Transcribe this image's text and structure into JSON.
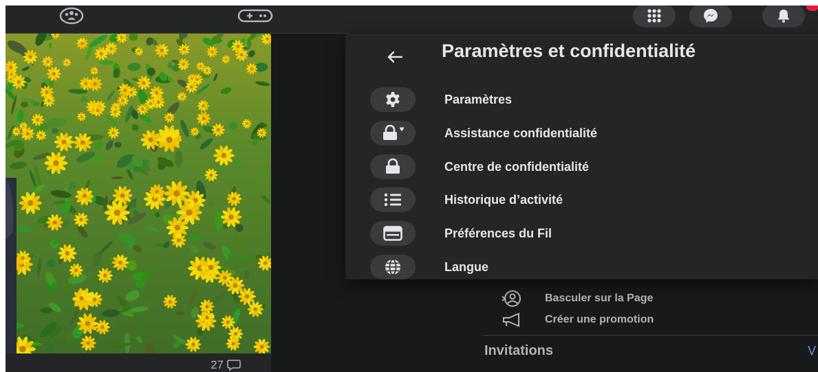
{
  "nav": {
    "groups_icon": "groups-icon",
    "gaming_icon": "gaming-icon",
    "menu_icon": "menu-grid-icon",
    "messenger_icon": "messenger-icon",
    "notifications_icon": "bell-icon"
  },
  "post": {
    "comment_count": "27"
  },
  "panel": {
    "title": "Paramètres et confidentialité",
    "items": [
      {
        "label": "Paramètres",
        "icon": "gear-icon"
      },
      {
        "label": "Assistance confidentialité",
        "icon": "lock-heart-icon"
      },
      {
        "label": "Centre de confidentialité",
        "icon": "lock-icon"
      },
      {
        "label": "Historique d’activité",
        "icon": "list-icon"
      },
      {
        "label": "Préférences du Fil",
        "icon": "feed-icon"
      },
      {
        "label": "Langue",
        "icon": "globe-icon"
      }
    ]
  },
  "sidebar": {
    "switch_page": "Basculer sur la Page",
    "create_promotion": "Créer une promotion",
    "invitations": "Invitations",
    "see_all": "V"
  },
  "colors": {
    "background": "#18191a",
    "surface": "#242526",
    "icon_bg": "#3a3b3c",
    "text_primary": "#e4e6eb",
    "text_secondary": "#b0b3b8",
    "link": "#5b9bd5"
  }
}
